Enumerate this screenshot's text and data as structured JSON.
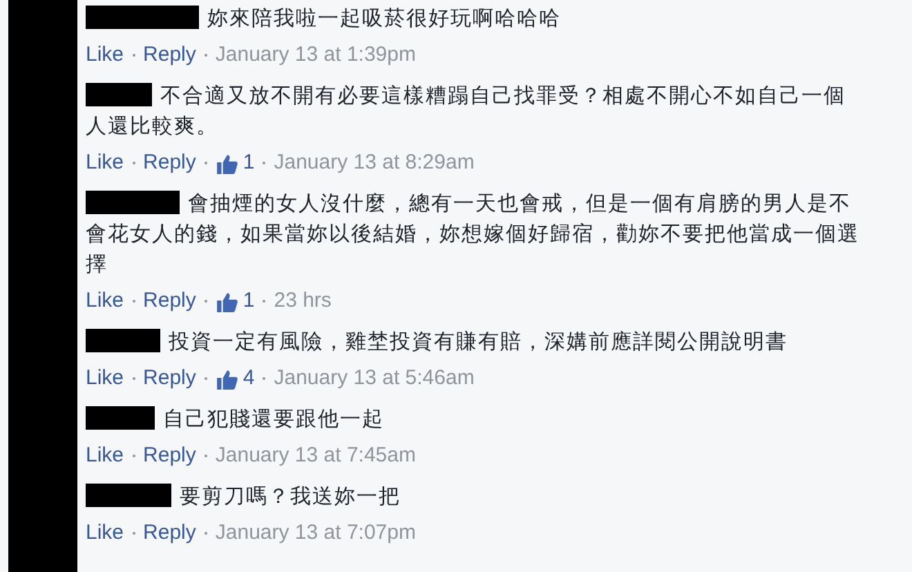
{
  "comments": [
    {
      "text": "妳來陪我啦一起吸菸很好玩啊哈哈哈",
      "like": "Like",
      "reply": "Reply",
      "time": "January 13 at 1:39pm"
    },
    {
      "text": "不合適又放不開有必要這樣糟蹋自己找罪受？相處不開心不如自己一個人還比較爽。",
      "like": "Like",
      "reply": "Reply",
      "likes": "1",
      "time": "January 13 at 8:29am"
    },
    {
      "text": "會抽煙的女人沒什麼，總有一天也會戒，但是一個有肩膀的男人是不會花女人的錢，如果當妳以後結婚，妳想嫁個好歸宿，勸妳不要把他當成一個選擇",
      "like": "Like",
      "reply": "Reply",
      "likes": "1",
      "time": "23 hrs"
    },
    {
      "text": "投資一定有風險，雞埜投資有賺有賠，深媾前應詳閱公開說明書",
      "like": "Like",
      "reply": "Reply",
      "likes": "4",
      "time": "January 13 at 5:46am"
    },
    {
      "text": "自己犯賤還要跟他一起",
      "like": "Like",
      "reply": "Reply",
      "time": "January 13 at 7:45am"
    },
    {
      "text": "要剪刀嗎？我送妳一把",
      "like": "Like",
      "reply": "Reply",
      "time": "January 13 at 7:07pm"
    }
  ]
}
